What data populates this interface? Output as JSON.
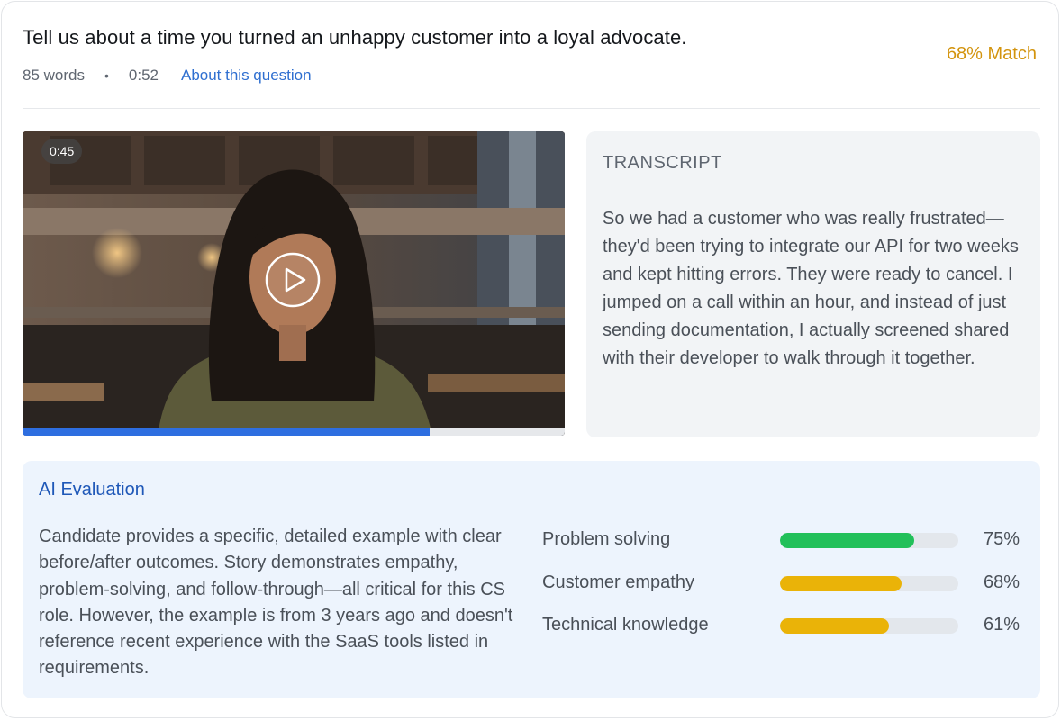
{
  "question": {
    "title": "Tell us about a time you turned an unhappy customer into a loyal advocate.",
    "word_count": "85 words",
    "separator": "•",
    "duration": "0:52",
    "about_link": "About this question"
  },
  "match": {
    "label": "68% Match",
    "color": "#d3940e"
  },
  "video": {
    "timestamp": "0:45",
    "progress": 0.75,
    "progress_color": "#2e6ee0",
    "play_icon": "play-icon"
  },
  "transcript": {
    "label": "TRANSCRIPT",
    "text": "So we had a customer who was really frustrated—they'd been trying to integrate our API for two weeks and kept hitting errors. They were ready to cancel. I jumped on a call within an hour, and instead of just sending documentation, I actually screened shared with their developer to walk through it together."
  },
  "evaluation": {
    "title": "AI Evaluation",
    "summary": "Candidate provides a specific, detailed example with clear before/after outcomes. Story demonstrates empathy, problem-solving, and follow-through—all critical for this CS role. However, the example is from 3 years ago and doesn't reference recent experience with the SaaS tools listed in requirements.",
    "metrics": [
      {
        "name": "Problem solving",
        "value": 75,
        "label": "75%",
        "color": "#22c05a"
      },
      {
        "name": "Customer empathy",
        "value": 68,
        "label": "68%",
        "color": "#eab308"
      },
      {
        "name": "Technical knowledge",
        "value": 61,
        "label": "61%",
        "color": "#eab308"
      }
    ]
  }
}
